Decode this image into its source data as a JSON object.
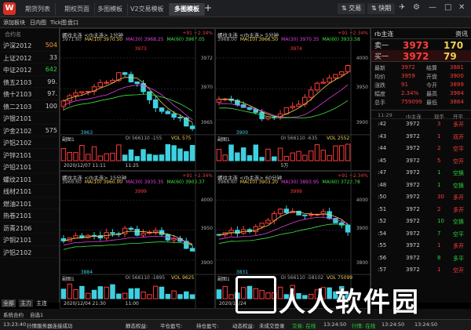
{
  "titlebar": {
    "tabs": [
      "期货列表",
      "期权页面",
      "多图模板",
      "V2交易模板",
      "多图模板"
    ],
    "active_tab": 4,
    "buttons": {
      "trade": "交易",
      "flash": "快期"
    }
  },
  "toolbar": {
    "items": [
      "添加板块",
      "日内图",
      "Tick图",
      "盘口"
    ]
  },
  "left_list": {
    "header": "合约名",
    "rows": [
      {
        "name": "沪深2012",
        "value": "504",
        "color": "#f0a030"
      },
      {
        "name": "上证2012",
        "value": "33",
        "color": "#ccc"
      },
      {
        "name": "中证2012",
        "value": "642",
        "color": "#2ad13a"
      },
      {
        "name": "债五2103",
        "value": "99.",
        "color": "#ccc"
      },
      {
        "name": "债十2103",
        "value": "97.",
        "color": "#ccc"
      },
      {
        "name": "债二2103",
        "value": "100",
        "color": "#ccc"
      },
      {
        "name": "沪银2101",
        "value": "",
        "color": "#ccc"
      },
      {
        "name": "沪金2102",
        "value": "575",
        "color": "#ccc"
      },
      {
        "name": "沪铝2102",
        "value": "",
        "color": "#ccc"
      },
      {
        "name": "沪锌2101",
        "value": "",
        "color": "#ccc"
      },
      {
        "name": "沪铅2101",
        "value": "",
        "color": "#ccc"
      },
      {
        "name": "螺纹2101",
        "value": "",
        "color": "#ccc"
      },
      {
        "name": "线材2101",
        "value": "",
        "color": "#ccc"
      },
      {
        "name": "燃油2101",
        "value": "",
        "color": "#ccc"
      },
      {
        "name": "热卷2101",
        "value": "",
        "color": "#ccc"
      },
      {
        "name": "沥青2106",
        "value": "",
        "color": "#ccc"
      },
      {
        "name": "沪铜2101",
        "value": "",
        "color": "#ccc"
      },
      {
        "name": "沪铝2102",
        "value": "",
        "color": "#ccc"
      }
    ],
    "bottom_tabs": [
      "全部",
      "主力",
      "主连"
    ],
    "bottom2": [
      "系统合约",
      "自选1"
    ]
  },
  "panels": [
    {
      "title": "螺纹主连 <rb主连> 1分钟",
      "ma": [
        "MA(10) 3970.50",
        "MA(30) 3968.25",
        "MA(60) 3967.05"
      ],
      "lead": "3971.60",
      "change": "+91 +2.34%",
      "hi": "3973",
      "lo": "3963",
      "yhi": "3972",
      "ylo": "3965",
      "ymid": "3970",
      "sub": "副图1",
      "oi": "OI 566110 -155",
      "vol": "VOL 575",
      "date": "2020/12/07 11:11",
      "time2": "11:25"
    },
    {
      "title": "螺纹主连 <rb主连> 5分钟",
      "ma": [
        "MA(10) 3966.50",
        "MA(30) 3970.35",
        "MA(60) 3933.58"
      ],
      "lead": "3968.00",
      "change": "+91 +2.34%",
      "hi": "3974",
      "lo": "3900",
      "yhi": "4000",
      "ylo": "3900",
      "ymid": "3950",
      "sub": "副图1",
      "oi": "OI 566110 -635",
      "vol": "VOL 2552",
      "date": "",
      "time2": "5万"
    },
    {
      "title": "螺纹主连 <rb主连> 15分钟",
      "ma": [
        "MA(10) 3960.00",
        "MA(30) 3935.35",
        "MA(60) 3903.37"
      ],
      "lead": "3966.60",
      "change": "+91 +2.34%",
      "hi": "3999",
      "lo": "3884",
      "yhi": "4000",
      "ylo": "3900",
      "ymid": "3950",
      "sub": "副图1",
      "oi": "OI 566110 -1895",
      "vol": "VOL 9625",
      "date": "2020/12/04 21:30",
      "time2": "11:00"
    },
    {
      "title": "螺纹主连 <rb主连> 60分钟",
      "ma": [
        "MA(10) 3903.20",
        "MA(30) 3893.95",
        "MA(60) 3722.78"
      ],
      "lead": "3966.60",
      "change": "+91 +2.34%",
      "hi": "3999",
      "lo": "3831",
      "yhi": "4000",
      "ylo": "3800",
      "ymid": "3900",
      "sub": "副图1",
      "oi": "OI 566110 -58102",
      "vol": "VOL 75099",
      "date": "2020/11/24",
      "time2": ""
    }
  ],
  "quote": {
    "symbol": "rb主连",
    "info": "资讯",
    "sell_label": "卖一",
    "sell_price": "3973",
    "sell_vol": "170",
    "buy_label": "买一",
    "buy_price": "3972",
    "buy_vol": "79",
    "stats": [
      [
        "最新",
        "3972",
        "结算",
        "3881"
      ],
      [
        "均价",
        "3959",
        "开盘",
        "3900"
      ],
      [
        "涨跌",
        "91",
        "今开",
        "3899"
      ],
      [
        "幅度",
        "2.34%",
        "最高",
        "3984"
      ],
      [
        "总手",
        "759099",
        "最低",
        "3884"
      ]
    ]
  },
  "ticks": {
    "headers": [
      "11:29",
      "rb主连",
      "现手",
      "开平"
    ],
    "rows": [
      [
        ":42",
        "3972",
        "3",
        "多开",
        "red"
      ],
      [
        ":43",
        "3972",
        "1",
        "双开",
        "red"
      ],
      [
        ":44",
        "3972",
        "2",
        "空平",
        "red"
      ],
      [
        ":45",
        "3972",
        "5",
        "空开",
        "red"
      ],
      [
        ":47",
        "3972",
        "1",
        "空换",
        "green"
      ],
      [
        ":48",
        "3972",
        "1",
        "空换",
        "green"
      ],
      [
        ":50",
        "3972",
        "30",
        "多开",
        "red"
      ],
      [
        ":51",
        "3972",
        "2",
        "多开",
        "red"
      ],
      [
        ":52",
        "3972",
        "10",
        "空换",
        "green"
      ],
      [
        ":54",
        "3972",
        "7",
        "空平",
        "green"
      ],
      [
        ":55",
        "3972",
        "1",
        "多开",
        "red"
      ],
      [
        ":56",
        "3972",
        "8",
        "多平",
        "green"
      ],
      [
        ":57",
        "3972",
        "1",
        "空开",
        "red"
      ]
    ]
  },
  "status": {
    "time": "13:23:40",
    "message": "行情服务器连接成功",
    "items": [
      "静态权益:",
      "平仓盈亏:",
      "持仓盈亏:",
      "动态权益:"
    ],
    "login": "未成交登录",
    "trade": "交易: 在线",
    "quote": "行情: 在线",
    "t1": "13:24:50",
    "t2": "13:24:50",
    "t3": "13:24:50"
  },
  "watermark": "人人软件园",
  "colors": {
    "up": "#ff3b3b",
    "down": "#2ad13a",
    "ma10": "#f0d050",
    "ma30": "#e040e0",
    "ma60": "#40e040"
  }
}
